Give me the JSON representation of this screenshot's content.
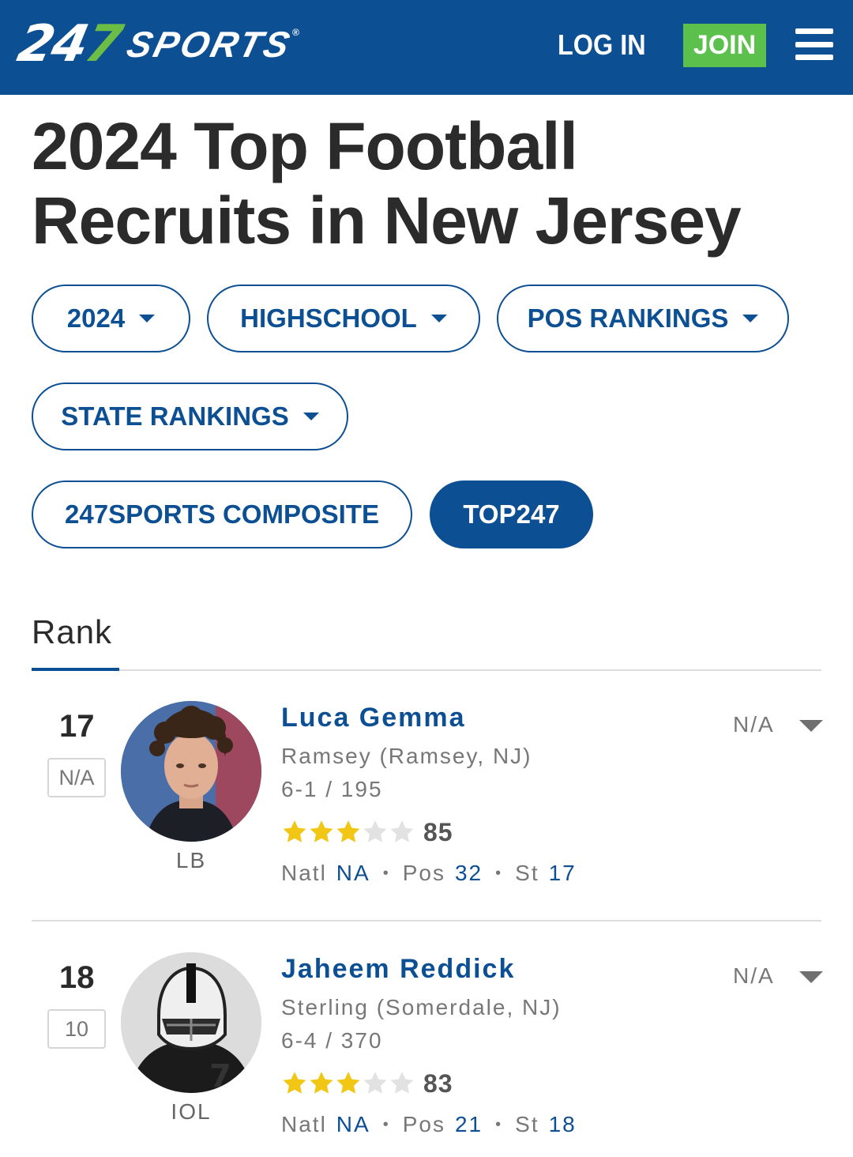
{
  "header": {
    "logo_digits": "247",
    "logo_word": "SPORTS",
    "login_label": "LOG IN",
    "join_label": "JOIN",
    "accent_color": "#0d4f93",
    "join_color": "#5cc04c"
  },
  "page_title": "2024 Top Football Recruits in New Jersey",
  "filters": [
    {
      "label": "2024"
    },
    {
      "label": "HIGHSCHOOL"
    },
    {
      "label": "POS RANKINGS"
    },
    {
      "label": "STATE RANKINGS"
    },
    {
      "label": "247SPORTS COMPOSITE"
    },
    {
      "label": "TOP247",
      "active": true
    }
  ],
  "tab": {
    "label": "Rank"
  },
  "players": [
    {
      "rank": "17",
      "prev_rank": "N/A",
      "position": "LB",
      "name": "Luca Gemma",
      "school": "Ramsey (Ramsey, NJ)",
      "measurements": "6-1 / 195",
      "stars": 3,
      "max_stars": 5,
      "score": "85",
      "natl_label": "Natl",
      "natl": "NA",
      "pos_label": "Pos",
      "pos_rank": "32",
      "st_label": "St",
      "st_rank": "17",
      "commit": "N/A"
    },
    {
      "rank": "18",
      "prev_rank": "10",
      "position": "IOL",
      "name": "Jaheem Reddick",
      "school": "Sterling (Somerdale, NJ)",
      "measurements": "6-4 / 370",
      "stars": 3,
      "max_stars": 5,
      "score": "83",
      "natl_label": "Natl",
      "natl": "NA",
      "pos_label": "Pos",
      "pos_rank": "21",
      "st_label": "St",
      "st_rank": "18",
      "commit": "N/A"
    }
  ]
}
